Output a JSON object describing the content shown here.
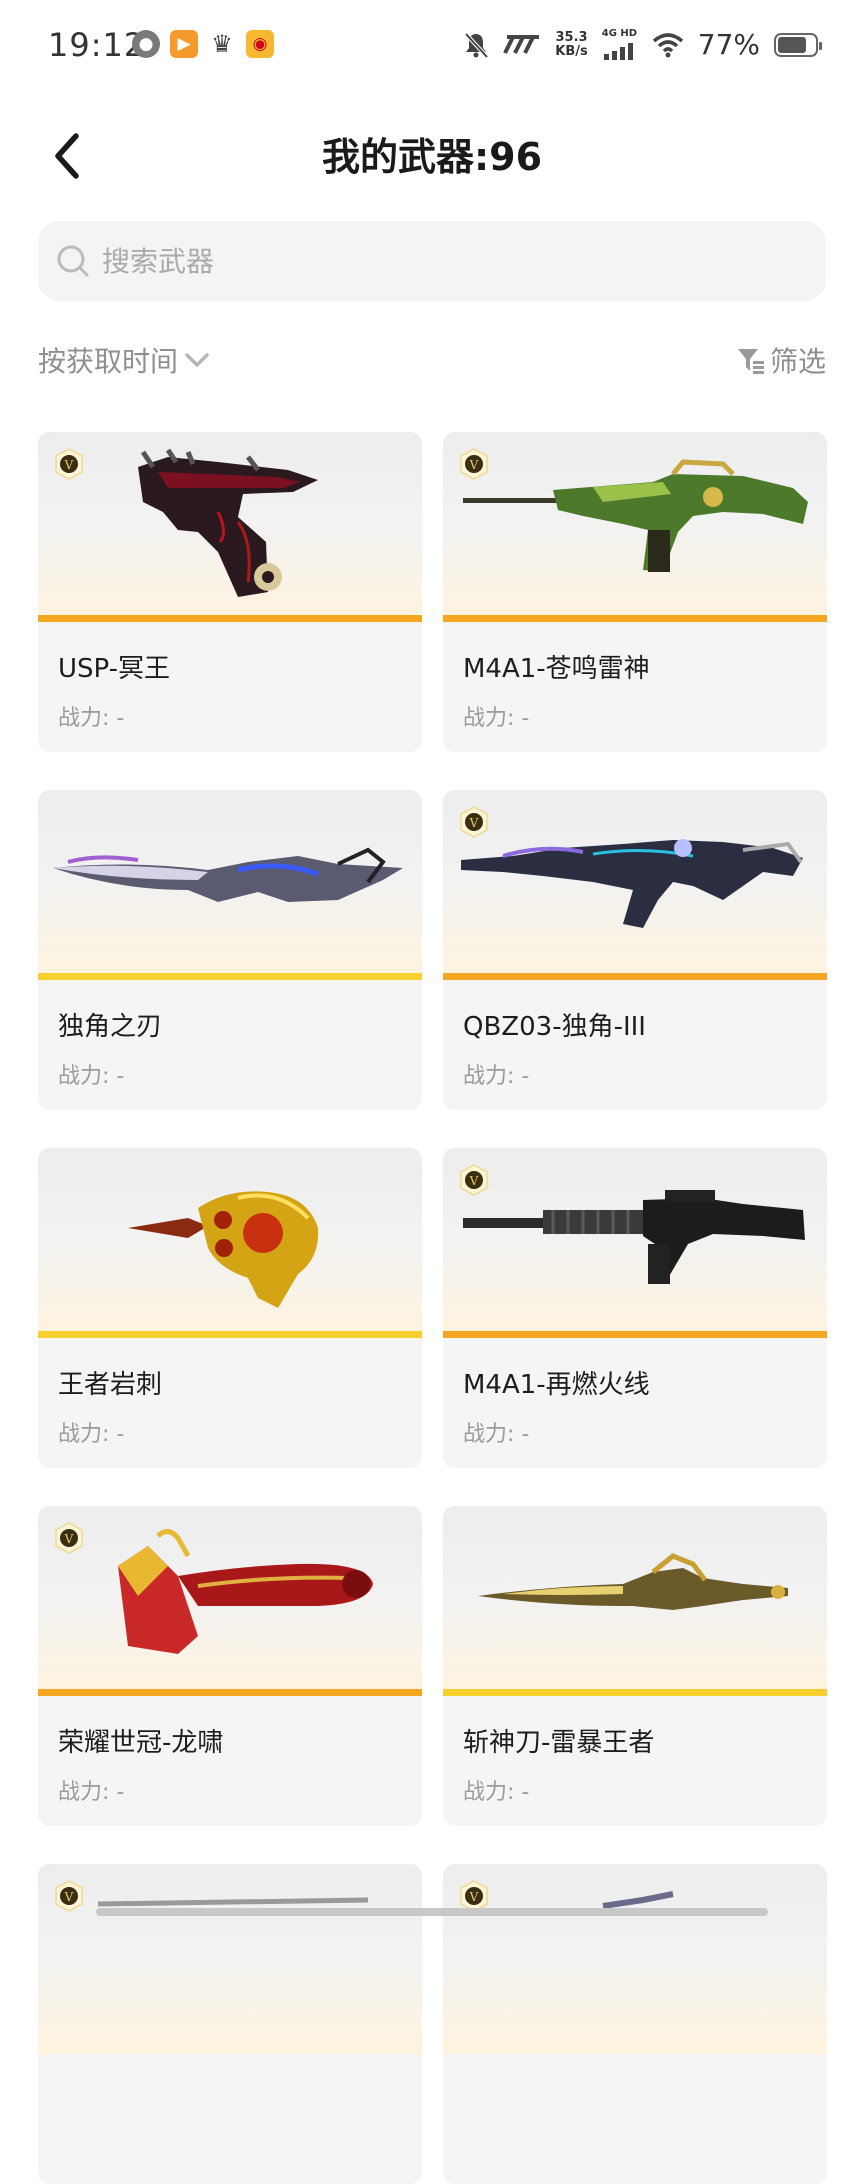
{
  "status": {
    "time": "19:12",
    "net_speed_value": "35.3",
    "net_speed_unit": "KB/s",
    "signal": "4G HD",
    "battery": "77%",
    "battery_level": 0.77
  },
  "header": {
    "title": "我的武器:96",
    "search_placeholder": "搜索武器"
  },
  "toolbar": {
    "sort_label": "按获取时间",
    "filter_label": "筛选"
  },
  "weapons": [
    {
      "name": "USP-冥王",
      "power": "战力: -",
      "vip": true,
      "stripe": "#f5a623"
    },
    {
      "name": "M4A1-苍鸣雷神",
      "power": "战力: -",
      "vip": true,
      "stripe": "#f5a623"
    },
    {
      "name": "独角之刃",
      "power": "战力: -",
      "vip": false,
      "stripe": "#f7cf2e"
    },
    {
      "name": "QBZ03-独角-III",
      "power": "战力: -",
      "vip": true,
      "stripe": "#f5a623"
    },
    {
      "name": "王者岩刺",
      "power": "战力: -",
      "vip": false,
      "stripe": "#f7cf2e"
    },
    {
      "name": "M4A1-再燃火线",
      "power": "战力: -",
      "vip": true,
      "stripe": "#f5a623"
    },
    {
      "name": "荣耀世冠-龙啸",
      "power": "战力: -",
      "vip": true,
      "stripe": "#f5a623"
    },
    {
      "name": "斩神刀-雷暴王者",
      "power": "战力: -",
      "vip": false,
      "stripe": "#f7cf2e"
    },
    {
      "name": "",
      "power": "",
      "vip": true,
      "stripe": "#f5a623"
    },
    {
      "name": "",
      "power": "",
      "vip": true,
      "stripe": "#f5a623"
    }
  ]
}
